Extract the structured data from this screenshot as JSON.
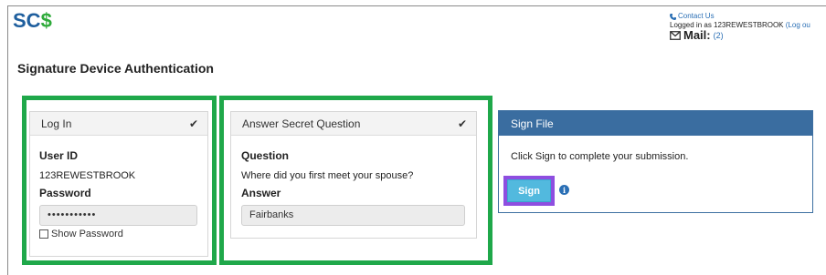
{
  "brand": {
    "logo_text": "SC",
    "logo_accent": "$"
  },
  "header": {
    "contact_label": "Contact Us",
    "logged_in_prefix": "Logged in as 123REWESTBROOK",
    "logout_label": "(Log ou",
    "mail_label": "Mail:",
    "mail_count": "(2)"
  },
  "page": {
    "title": "Signature Device Authentication"
  },
  "login_panel": {
    "title": "Log In",
    "check": "✔",
    "user_id_label": "User ID",
    "user_id_value": "123REWESTBROOK",
    "password_label": "Password",
    "password_value": "•••••••••••",
    "show_password_label": "Show Password"
  },
  "question_panel": {
    "title": "Answer Secret Question",
    "check": "✔",
    "question_label": "Question",
    "question_text": "Where did you first meet your spouse?",
    "answer_label": "Answer",
    "answer_value": "Fairbanks"
  },
  "sign_panel": {
    "title": "Sign File",
    "instruction": "Click Sign to complete your submission.",
    "sign_label": "Sign",
    "info_glyph": "i"
  },
  "colors": {
    "highlight_green": "#1fa84a",
    "highlight_purple": "#8e4ee0",
    "sign_header": "#3a6da0",
    "sign_button": "#52b9de",
    "brand_blue": "#1f5f9e",
    "brand_green": "#2eaa3a"
  }
}
